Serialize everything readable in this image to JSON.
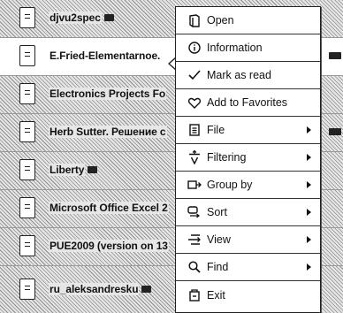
{
  "files": [
    {
      "title": "djvu2spec",
      "badge": true,
      "right_badge": false,
      "selected": false
    },
    {
      "title": "E.Fried-Elementarnoe.",
      "badge": false,
      "right_badge": true,
      "selected": true
    },
    {
      "title": "Electronics Projects Fo",
      "badge": false,
      "right_badge": false,
      "selected": false
    },
    {
      "title": "Herb Sutter. Решение с",
      "badge": false,
      "right_badge": true,
      "selected": false
    },
    {
      "title": "Liberty",
      "badge": true,
      "right_badge": false,
      "selected": false
    },
    {
      "title": "Microsoft Office Excel 2",
      "badge": false,
      "right_badge": false,
      "selected": false
    },
    {
      "title": "PUE2009 (version on 13",
      "badge": false,
      "right_badge": false,
      "selected": false
    },
    {
      "title": "ru_aleksandresku",
      "badge": true,
      "right_badge": false,
      "selected": false
    }
  ],
  "menu": {
    "items": [
      {
        "label": "Open",
        "icon": "book-open-icon",
        "submenu": false
      },
      {
        "label": "Information",
        "icon": "info-icon",
        "submenu": false
      },
      {
        "label": "Mark as read",
        "icon": "checkmark-icon",
        "submenu": false
      },
      {
        "label": "Add to Favorites",
        "icon": "heart-icon",
        "submenu": false
      },
      {
        "label": "File",
        "icon": "file-icon",
        "submenu": true
      },
      {
        "label": "Filtering",
        "icon": "filter-icon",
        "submenu": true
      },
      {
        "label": "Group by",
        "icon": "group-icon",
        "submenu": true
      },
      {
        "label": "Sort",
        "icon": "sort-icon",
        "submenu": true
      },
      {
        "label": "View",
        "icon": "view-icon",
        "submenu": true
      },
      {
        "label": "Find",
        "icon": "search-icon",
        "submenu": true
      },
      {
        "label": "Exit",
        "icon": "exit-icon",
        "submenu": false
      }
    ]
  }
}
